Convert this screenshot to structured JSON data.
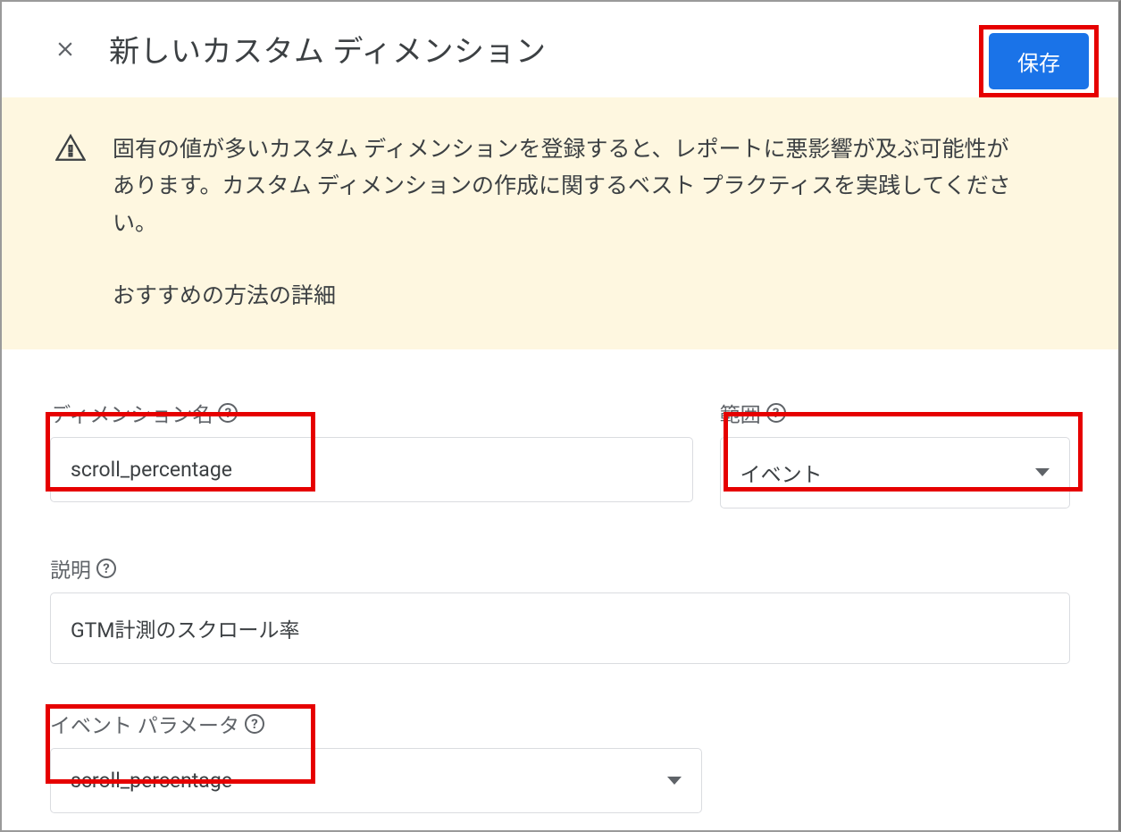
{
  "header": {
    "title": "新しいカスタム ディメンション",
    "save_label": "保存"
  },
  "warning": {
    "text": "固有の値が多いカスタム ディメンションを登録すると、レポートに悪影響が及ぶ可能性があります。カスタム ディメンションの作成に関するベスト プラクティスを実践してください。",
    "link": "おすすめの方法の詳細"
  },
  "form": {
    "dimension_name": {
      "label": "ディメンション名",
      "value": "scroll_percentage"
    },
    "scope": {
      "label": "範囲",
      "value": "イベント"
    },
    "description": {
      "label": "説明",
      "value": "GTM計測のスクロール率"
    },
    "event_parameter": {
      "label": "イベント パラメータ",
      "value": "scroll_percentage"
    }
  }
}
